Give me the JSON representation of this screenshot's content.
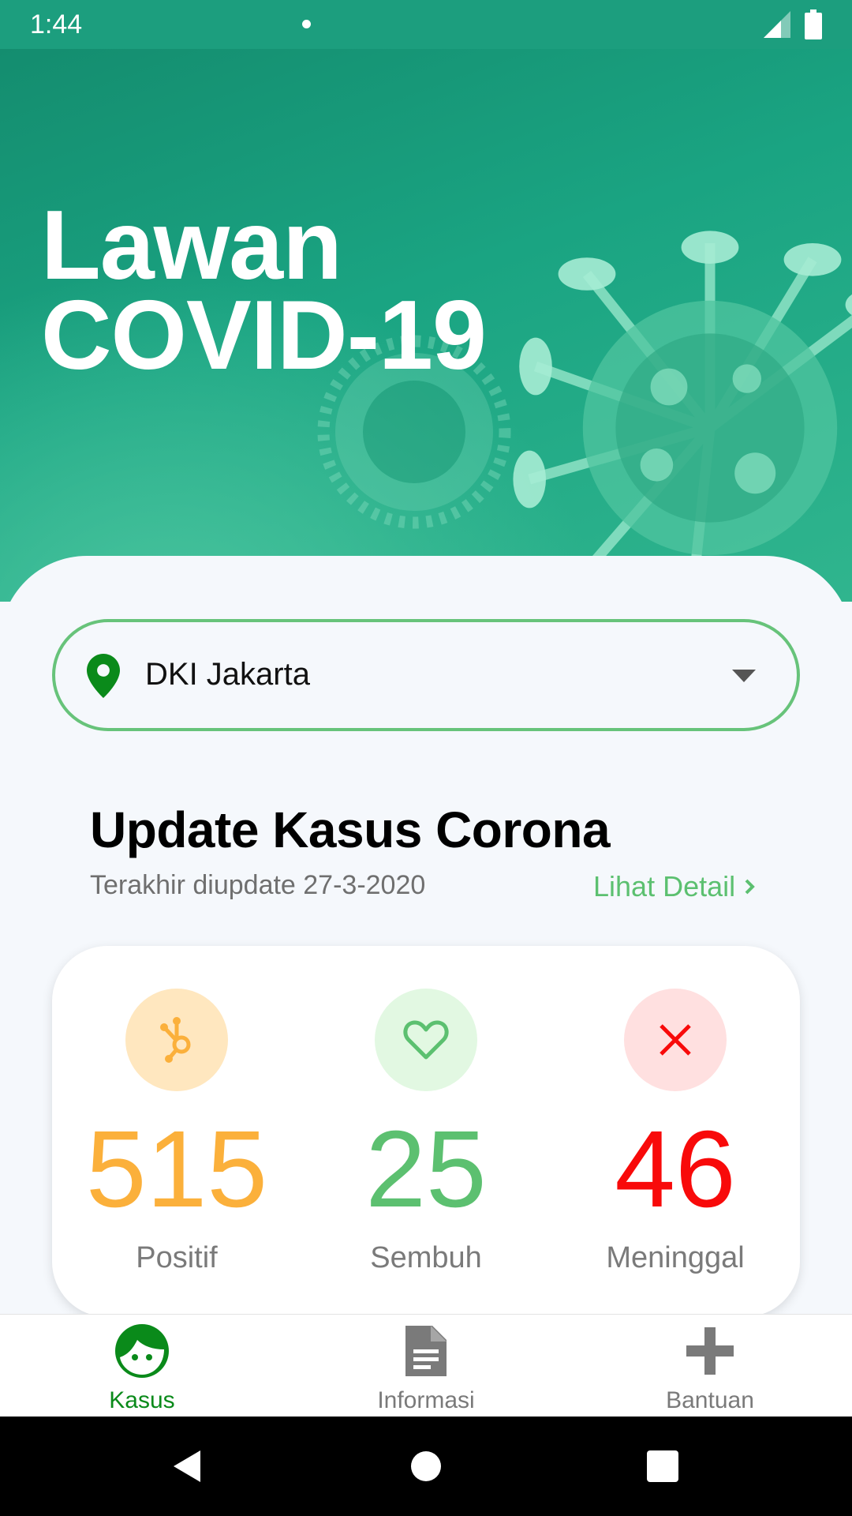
{
  "status_bar": {
    "time": "1:44"
  },
  "hero": {
    "title_line1": "Lawan",
    "title_line2": "COVID-19"
  },
  "location": {
    "selected": "DKI Jakarta"
  },
  "section": {
    "title": "Update Kasus Corona",
    "subtitle": "Terakhir diupdate 27-3-2020",
    "detail_link": "Lihat Detail"
  },
  "stats": [
    {
      "value": "515",
      "label": "Positif",
      "color": "#fbb03b",
      "bg": "#ffe7bf",
      "icon": "virus-icon"
    },
    {
      "value": "25",
      "label": "Sembuh",
      "color": "#5cc070",
      "bg": "#e2f8e2",
      "icon": "heart-icon"
    },
    {
      "value": "46",
      "label": "Meninggal",
      "color": "#f80a0a",
      "bg": "#ffe0e0",
      "icon": "close-icon"
    }
  ],
  "bottom_nav": {
    "items": [
      {
        "label": "Kasus",
        "icon": "face-icon",
        "active": true
      },
      {
        "label": "Informasi",
        "icon": "document-icon",
        "active": false
      },
      {
        "label": "Bantuan",
        "icon": "plus-icon",
        "active": false
      }
    ],
    "active_color": "#0a8a1a",
    "inactive_color": "#7a7a7a"
  }
}
